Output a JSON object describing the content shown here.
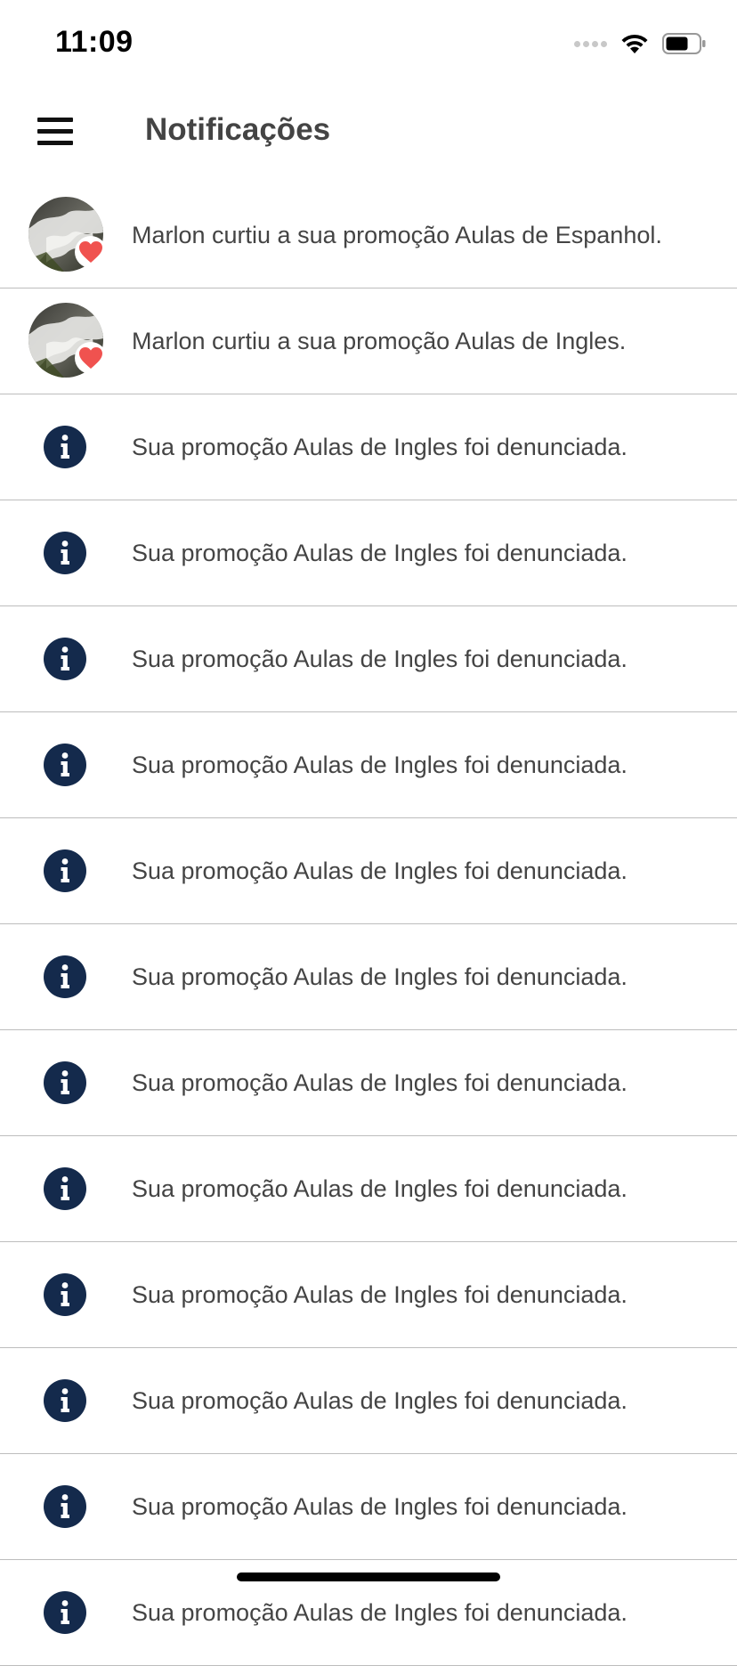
{
  "status_bar": {
    "time": "11:09"
  },
  "header": {
    "title": "Notificações"
  },
  "notifications": [
    {
      "type": "like",
      "text": "Marlon curtiu a sua promoção Aulas de Espanhol."
    },
    {
      "type": "like",
      "text": "Marlon curtiu a sua promoção Aulas de Ingles."
    },
    {
      "type": "info",
      "text": "Sua promoção Aulas de Ingles foi denunciada."
    },
    {
      "type": "info",
      "text": "Sua promoção Aulas de Ingles foi denunciada."
    },
    {
      "type": "info",
      "text": "Sua promoção Aulas de Ingles foi denunciada."
    },
    {
      "type": "info",
      "text": "Sua promoção Aulas de Ingles foi denunciada."
    },
    {
      "type": "info",
      "text": "Sua promoção Aulas de Ingles foi denunciada."
    },
    {
      "type": "info",
      "text": "Sua promoção Aulas de Ingles foi denunciada."
    },
    {
      "type": "info",
      "text": "Sua promoção Aulas de Ingles foi denunciada."
    },
    {
      "type": "info",
      "text": "Sua promoção Aulas de Ingles foi denunciada."
    },
    {
      "type": "info",
      "text": "Sua promoção Aulas de Ingles foi denunciada."
    },
    {
      "type": "info",
      "text": "Sua promoção Aulas de Ingles foi denunciada."
    },
    {
      "type": "info",
      "text": "Sua promoção Aulas de Ingles foi denunciada."
    },
    {
      "type": "info",
      "text": "Sua promoção Aulas de Ingles foi denunciada."
    }
  ],
  "icons": {
    "menu": "hamburger-menu-icon",
    "info": "info-circle-icon",
    "like": "heart-icon",
    "wifi": "wifi-icon",
    "battery": "battery-icon",
    "signal": "signal-icon"
  },
  "colors": {
    "info_icon": "#142a4c",
    "heart": "#f0524f",
    "divider": "#bdbdbd",
    "text": "#444444"
  }
}
